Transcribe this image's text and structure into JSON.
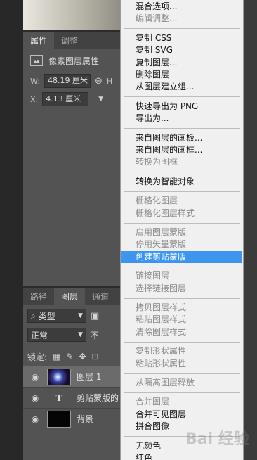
{
  "properties": {
    "tabs": [
      {
        "label": "属性",
        "active": true
      },
      {
        "label": "调整",
        "active": false
      }
    ],
    "title": "像素图层属性",
    "w_label": "W:",
    "w_value": "48.19 厘米",
    "x_label": "X:",
    "x_value": "4.13 厘米",
    "h_hint": "H"
  },
  "layers_panel": {
    "tabs": [
      {
        "label": "路径",
        "active": false
      },
      {
        "label": "图层",
        "active": true
      },
      {
        "label": "通道",
        "active": false
      }
    ],
    "filter_label": "类型",
    "blend_mode": "正常",
    "opacity_hint": "不",
    "lock_label": "锁定:",
    "layers": [
      {
        "name": "图层 1",
        "type": "image",
        "selected": true
      },
      {
        "name": "剪贴蒙版的",
        "type": "text",
        "selected": false
      },
      {
        "name": "背景",
        "type": "fill",
        "selected": false
      }
    ]
  },
  "menu": {
    "groups": [
      [
        {
          "label": "混合选项...",
          "enabled": true
        },
        {
          "label": "编辑调整...",
          "enabled": false
        }
      ],
      [
        {
          "label": "复制 CSS",
          "enabled": true
        },
        {
          "label": "复制 SVG",
          "enabled": true
        },
        {
          "label": "复制图层...",
          "enabled": true
        },
        {
          "label": "删除图层",
          "enabled": true
        },
        {
          "label": "从图层建立组...",
          "enabled": true
        }
      ],
      [
        {
          "label": "快速导出为 PNG",
          "enabled": true
        },
        {
          "label": "导出为...",
          "enabled": true
        }
      ],
      [
        {
          "label": "来自图层的画板...",
          "enabled": true
        },
        {
          "label": "来自图层的画框...",
          "enabled": true
        },
        {
          "label": "转换为图框",
          "enabled": false
        }
      ],
      [
        {
          "label": "转换为智能对象",
          "enabled": true
        }
      ],
      [
        {
          "label": "栅格化图层",
          "enabled": false
        },
        {
          "label": "栅格化图层样式",
          "enabled": false
        }
      ],
      [
        {
          "label": "启用图层蒙版",
          "enabled": false
        },
        {
          "label": "停用矢量蒙版",
          "enabled": false
        },
        {
          "label": "创建剪贴蒙版",
          "enabled": true,
          "highlighted": true
        }
      ],
      [
        {
          "label": "链接图层",
          "enabled": false
        },
        {
          "label": "选择链接图层",
          "enabled": false
        }
      ],
      [
        {
          "label": "拷贝图层样式",
          "enabled": false
        },
        {
          "label": "粘贴图层样式",
          "enabled": false
        },
        {
          "label": "清除图层样式",
          "enabled": false
        }
      ],
      [
        {
          "label": "复制形状属性",
          "enabled": false
        },
        {
          "label": "粘贴形状属性",
          "enabled": false
        }
      ],
      [
        {
          "label": "从隔离图层释放",
          "enabled": false
        }
      ],
      [
        {
          "label": "合并图层",
          "enabled": false
        },
        {
          "label": "合并可见图层",
          "enabled": true
        },
        {
          "label": "拼合图像",
          "enabled": true
        }
      ],
      [
        {
          "label": "无颜色",
          "enabled": true
        },
        {
          "label": "红色",
          "enabled": true
        }
      ]
    ]
  },
  "watermark": "Bai 经验"
}
